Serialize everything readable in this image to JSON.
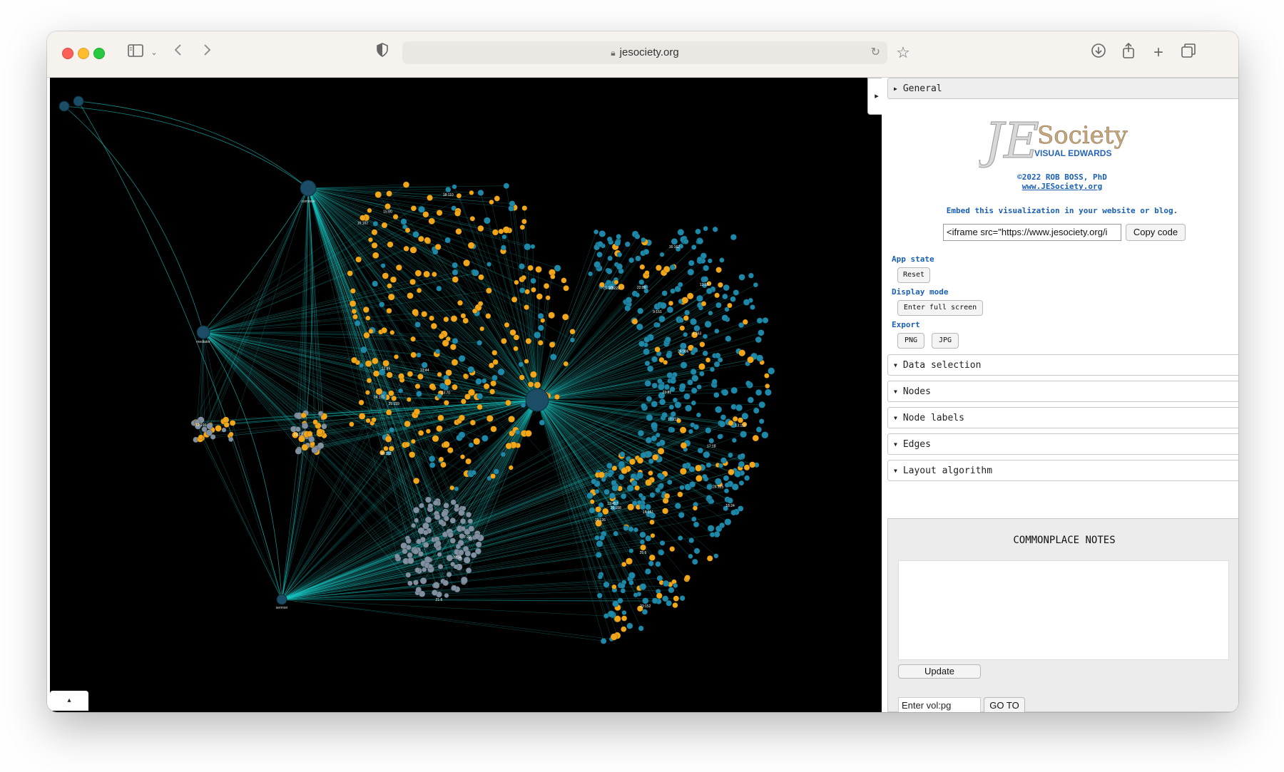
{
  "browser": {
    "url": "jesociety.org"
  },
  "graph": {
    "expand_toggle": "▸",
    "bottom_toggle": "▴",
    "hub_labels": [
      "common",
      "mediator",
      "sermon"
    ],
    "node_labels": [
      "9:151",
      "13:457",
      "24:906",
      "23:152",
      "16:162",
      "12:19",
      "18:24",
      "4:163",
      "17:212",
      "21:175",
      "26:158",
      "24:125",
      "22:80",
      "14:151",
      "19:126",
      "15:80",
      "25:159",
      "13:44",
      "20:152",
      "23:70",
      "12:45",
      "18:110",
      "24:165",
      "16:162",
      "21:6",
      "7:22",
      "28:34",
      "12:156",
      "19:22",
      "23:81",
      "13:112",
      "25:6",
      "20:222",
      "17:18"
    ],
    "colors": {
      "edge": "#19c5c2",
      "gold": "#f2a61a",
      "teal": "#1e88a8",
      "gray": "#8090a0",
      "hub": "#1b4e66"
    }
  },
  "panel": {
    "general_label": "General",
    "logo_main": "JE Society",
    "logo_sub": "VISUAL EDWARDS",
    "copyright": "©2022 ROB BOSS, PhD",
    "site_link": "www.JESociety.org",
    "embed_text": "Embed this visualization in your website or blog.",
    "embed_value": "<iframe src=\"https://www.jesociety.org/i",
    "copy_code": "Copy code",
    "app_state_label": "App state",
    "reset": "Reset",
    "display_mode_label": "Display mode",
    "fullscreen": "Enter full screen",
    "export_label": "Export",
    "png": "PNG",
    "jpg": "JPG",
    "sections": [
      "Data selection",
      "Nodes",
      "Node labels",
      "Edges",
      "Layout algorithm"
    ],
    "notes_title": "COMMONPLACE NOTES",
    "update": "Update",
    "vol_placeholder": "Enter vol:pg",
    "goto": "GO TO"
  }
}
